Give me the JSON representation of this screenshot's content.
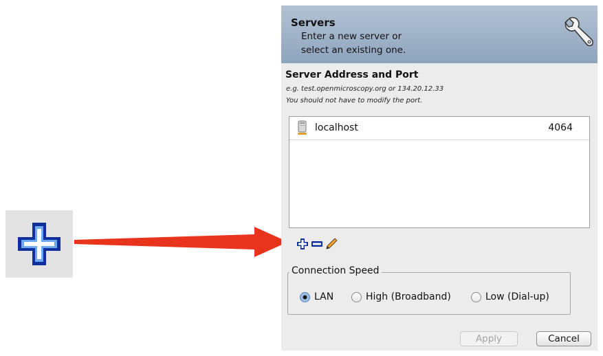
{
  "dialog": {
    "header": {
      "title": "Servers",
      "subtitle_line1": "Enter a new server or",
      "subtitle_line2": "select an existing one.",
      "icon": "wrench-icon"
    },
    "section_title": "Server Address and Port",
    "hint_line1": "e.g. test.openmicroscopy.org or 134.20.12.33",
    "hint_line2": "You should not have to modify the port.",
    "servers": [
      {
        "name": "localhost",
        "port": "4064",
        "icon": "server-icon"
      }
    ],
    "toolbar": {
      "add_icon": "plus-icon",
      "remove_icon": "minus-icon",
      "edit_icon": "pencil-icon"
    },
    "connection_speed": {
      "legend": "Connection Speed",
      "options": [
        {
          "label": "LAN",
          "checked": true
        },
        {
          "label": "High (Broadband)",
          "checked": false
        },
        {
          "label": "Low (Dial-up)",
          "checked": false
        }
      ]
    },
    "buttons": {
      "apply": "Apply",
      "apply_enabled": false,
      "cancel": "Cancel"
    }
  },
  "callout": {
    "zoom_icon": "plus-icon",
    "arrow_color": "#e8341c"
  },
  "colors": {
    "accent_blue": "#1a54c8",
    "header_gradient_top": "#b3c2d4",
    "header_gradient_bottom": "#8ea4bd"
  }
}
